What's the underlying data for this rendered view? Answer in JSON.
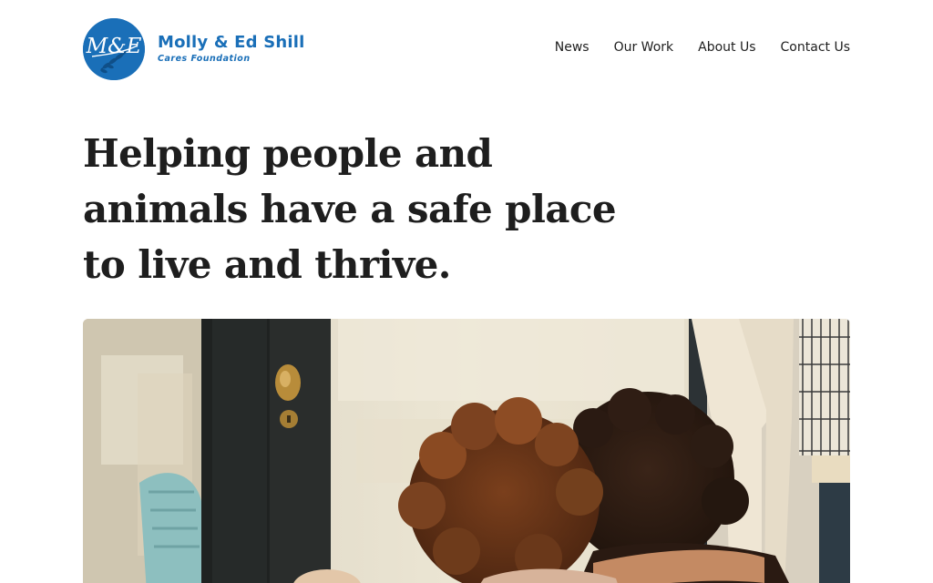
{
  "header": {
    "logo": {
      "monogram": "M&E",
      "title": "Molly & Ed Shill",
      "subtitle": "Cares Foundation"
    },
    "nav": [
      {
        "label": "News"
      },
      {
        "label": "Our Work"
      },
      {
        "label": "About Us"
      },
      {
        "label": "Contact Us"
      }
    ]
  },
  "hero": {
    "heading": "Helping people and animals have a safe place to live and thrive."
  },
  "colors": {
    "brand": "#1a6fb8",
    "text": "#1e1e1e",
    "background": "#ffffff"
  }
}
